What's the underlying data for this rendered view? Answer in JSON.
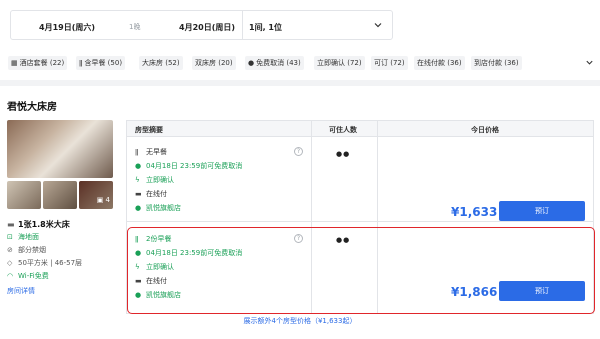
{
  "search": {
    "checkin": "4月19日(周六)",
    "nights": "1晚",
    "checkout": "4月20日(周日)",
    "rooms_guests": "1间, 1位"
  },
  "filters": [
    {
      "icon": "package-icon",
      "label": "酒店套餐 (22)"
    },
    {
      "icon": "utensils-icon",
      "label": "含早餐 (50)"
    },
    {
      "icon": "",
      "label": "大床房 (52)"
    },
    {
      "icon": "",
      "label": "双床房 (20)"
    },
    {
      "icon": "check-circle-icon",
      "label": "免费取消 (43)"
    },
    {
      "icon": "",
      "label": "立即确认 (72)"
    },
    {
      "icon": "",
      "label": "可订 (72)"
    },
    {
      "icon": "",
      "label": "在线付款 (36)"
    },
    {
      "icon": "",
      "label": "到店付款 (36)"
    }
  ],
  "room": {
    "title": "君悦大床房",
    "photo_count": "4",
    "bed": "1张1.8米大床",
    "features": [
      "海地面",
      "部分禁烟",
      "50平方米 | 46-57层",
      "Wi-Fi免费"
    ],
    "details_link": "房间详情"
  },
  "table": {
    "headers": {
      "plan": "房型摘要",
      "guests": "可住人数",
      "price": "今日价格"
    },
    "plans": [
      {
        "breakfast": "无早餐",
        "cancel": "04月18日 23:59前可免费取消",
        "confirm": "立即确认",
        "payment": "在线付",
        "store": "凯悦旗舰店",
        "guests": "2",
        "price": "¥1,633",
        "book": "预订"
      },
      {
        "breakfast": "2份早餐",
        "cancel": "04月18日 23:59前可免费取消",
        "confirm": "立即确认",
        "payment": "在线付",
        "store": "凯悦旗舰店",
        "guests": "2",
        "price": "¥1,866",
        "book": "预订"
      }
    ]
  },
  "more_link": "展示额外4个房型价格（¥1,633起）",
  "colors": {
    "accent": "#2b6be6",
    "green": "#1aa057",
    "highlight": "#e0262b"
  }
}
